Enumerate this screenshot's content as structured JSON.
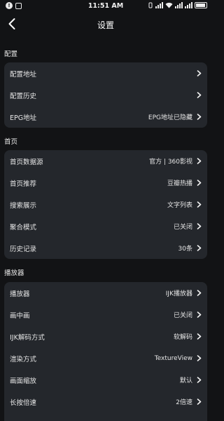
{
  "status_bar": {
    "time": "11:51 AM",
    "left_icons": [
      "notification-icon",
      "app-icon"
    ],
    "right_icons": [
      "vibrate-icon",
      "signal-icon",
      "wifi-icon",
      "signal-icon",
      "signal-icon",
      "battery-icon"
    ]
  },
  "header": {
    "title": "设置"
  },
  "sections": [
    {
      "label": "配置",
      "rows": [
        {
          "label": "配置地址",
          "value": ""
        },
        {
          "label": "配置历史",
          "value": ""
        },
        {
          "label": "EPG地址",
          "value": "EPG地址已隐藏"
        }
      ]
    },
    {
      "label": "首页",
      "rows": [
        {
          "label": "首页数据源",
          "value": "官方 | 360影视"
        },
        {
          "label": "首页推荐",
          "value": "豆瓣热播"
        },
        {
          "label": "搜索展示",
          "value": "文字列表"
        },
        {
          "label": "聚合模式",
          "value": "已关闭"
        },
        {
          "label": "历史记录",
          "value": "30条"
        }
      ]
    },
    {
      "label": "播放器",
      "rows": [
        {
          "label": "播放器",
          "value": "IJK播放器"
        },
        {
          "label": "画中画",
          "value": "已关闭"
        },
        {
          "label": "IJK解码方式",
          "value": "软解码"
        },
        {
          "label": "渲染方式",
          "value": "TextureView"
        },
        {
          "label": "画面缩放",
          "value": "默认"
        },
        {
          "label": "长按倍速",
          "value": "2倍速"
        }
      ]
    }
  ],
  "colors": {
    "background": "#121315",
    "card": "#24272c",
    "text": "#e6e6e6"
  }
}
